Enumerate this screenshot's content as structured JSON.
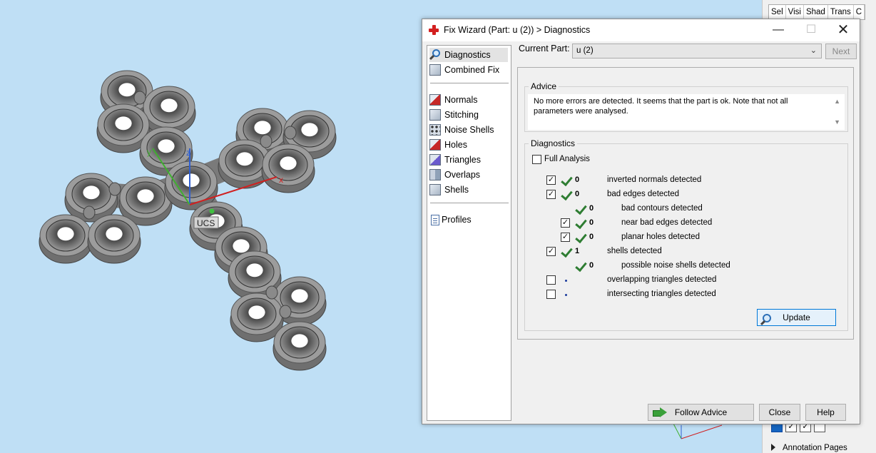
{
  "dialog": {
    "title": "Fix Wizard (Part: u (2)) > Diagnostics",
    "window_controls": {
      "minimize": "—",
      "maximize": "☐",
      "close": "✕"
    }
  },
  "nav": {
    "items": [
      {
        "label": "Diagnostics",
        "icon": "magnifier-icon"
      },
      {
        "label": "Combined Fix",
        "icon": "combined-fix-icon"
      },
      {
        "label": "Normals",
        "icon": "normals-icon"
      },
      {
        "label": "Stitching",
        "icon": "stitching-icon"
      },
      {
        "label": "Noise Shells",
        "icon": "noise-shells-icon"
      },
      {
        "label": "Holes",
        "icon": "holes-icon"
      },
      {
        "label": "Triangles",
        "icon": "triangles-icon"
      },
      {
        "label": "Overlaps",
        "icon": "overlaps-icon"
      },
      {
        "label": "Shells",
        "icon": "shells-icon"
      },
      {
        "label": "Profiles",
        "icon": "profiles-icon"
      }
    ]
  },
  "current_part": {
    "label": "Current Part:",
    "value": "u (2)",
    "next_label": "Next"
  },
  "advice": {
    "title": "Advice",
    "text": "No more errors are detected. It seems that the part is ok. Note that not all parameters were analysed."
  },
  "diagnostics": {
    "title": "Diagnostics",
    "full_analysis_label": "Full Analysis",
    "rows": [
      {
        "count": "0",
        "label": "inverted normals detected"
      },
      {
        "count": "0",
        "label": "bad edges detected"
      },
      {
        "count": "0",
        "label": "bad contours detected"
      },
      {
        "count": "0",
        "label": "near bad edges detected"
      },
      {
        "count": "0",
        "label": "planar holes detected"
      },
      {
        "count": "1",
        "label": "shells detected"
      },
      {
        "count": "0",
        "label": "possible noise shells detected"
      },
      {
        "count": "",
        "label": "overlapping triangles detected"
      },
      {
        "count": "",
        "label": "intersecting triangles detected"
      }
    ],
    "update_label": "Update"
  },
  "footer": {
    "follow_label": "Follow Advice",
    "close_label": "Close",
    "help_label": "Help"
  },
  "right_panel": {
    "columns": [
      "Sel",
      "Visi",
      "Shad",
      "Trans",
      "C"
    ],
    "annotation_label": "Annotation Pages"
  },
  "viewport": {
    "ucs_label": "UCS",
    "axis_x": "x",
    "axis_y": "y",
    "axis_z": "z"
  },
  "colors": {
    "viewport_bg": "#bfdff5",
    "part_gray": "#8a8a8a",
    "check_green": "#2e7d32",
    "accent_blue": "#0078d7"
  }
}
